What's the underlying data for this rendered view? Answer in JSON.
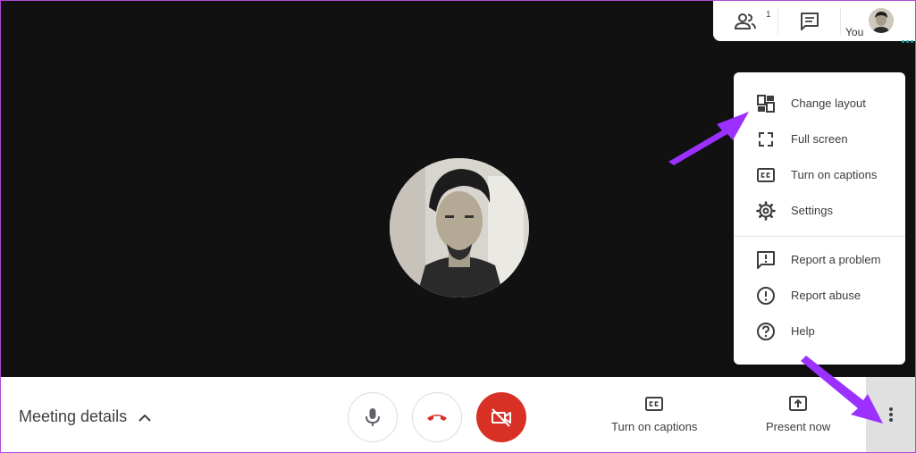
{
  "top_bar": {
    "participants_count": "1",
    "self_label": "You"
  },
  "more_menu": {
    "items": [
      {
        "label": "Change layout",
        "icon": "layout-icon"
      },
      {
        "label": "Full screen",
        "icon": "fullscreen-icon"
      },
      {
        "label": "Turn on captions",
        "icon": "captions-icon"
      },
      {
        "label": "Settings",
        "icon": "gear-icon"
      },
      {
        "label": "Report a problem",
        "icon": "feedback-icon"
      },
      {
        "label": "Report abuse",
        "icon": "alert-icon"
      },
      {
        "label": "Help",
        "icon": "help-icon"
      }
    ]
  },
  "bottom_bar": {
    "meeting_details_label": "Meeting details",
    "captions_label": "Turn on captions",
    "present_label": "Present now"
  },
  "colors": {
    "stage_bg": "#111111",
    "hangup_red": "#d93025",
    "arrow_purple": "#9b30ff",
    "status_teal": "#12a4a4"
  }
}
